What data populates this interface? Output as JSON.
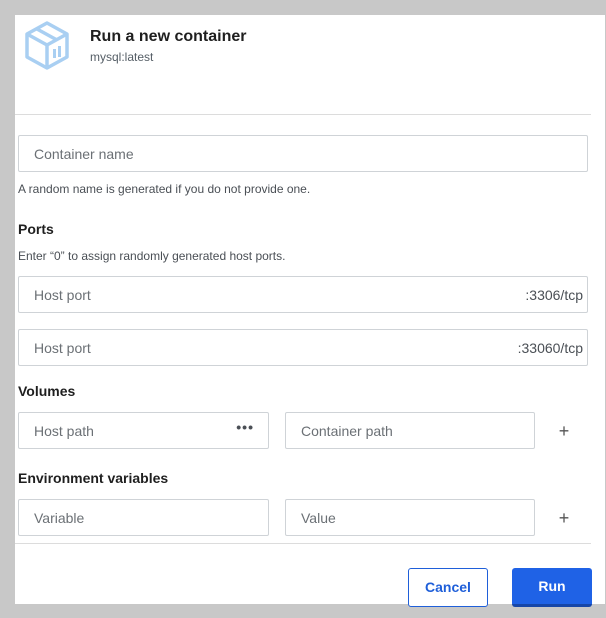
{
  "dialog": {
    "title": "Run a new container",
    "image": "mysql:latest",
    "icon": "container-box-icon"
  },
  "container_name": {
    "placeholder": "Container name",
    "hint": "A random name is generated if you do not provide one."
  },
  "ports": {
    "heading": "Ports",
    "hint": "Enter “0” to assign randomly generated host ports.",
    "rows": [
      {
        "placeholder": "Host port",
        "container_port": ":3306/tcp"
      },
      {
        "placeholder": "Host port",
        "container_port": ":33060/tcp"
      }
    ]
  },
  "volumes": {
    "heading": "Volumes",
    "host_path_placeholder": "Host path",
    "browse_label": "•••",
    "container_path_placeholder": "Container path",
    "add_label": "+"
  },
  "env": {
    "heading": "Environment variables",
    "variable_placeholder": "Variable",
    "value_placeholder": "Value",
    "add_label": "+"
  },
  "actions": {
    "cancel_label": "Cancel",
    "run_label": "Run"
  },
  "colors": {
    "accent": "#1f62e6",
    "icon": "#a9cff2"
  }
}
